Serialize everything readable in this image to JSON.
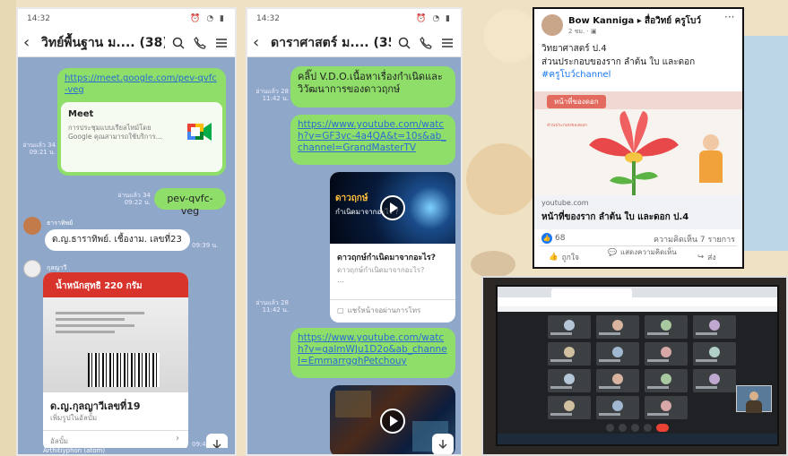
{
  "chat1": {
    "status_time": "14:32",
    "title": "วิทย์พื้นฐาน ม.... (38)",
    "link_text": "https://meet.google.com/pev-qvfc-veg",
    "meet_title": "Meet",
    "meet_desc": "การประชุมแบบเรียลไทม์โดย Google คุณสามารถใช้บริการ...",
    "read_ts1": "อ่านแล้ว 34",
    "time_ts1": "09:21 น.",
    "read_ts2": "อ่านแล้ว 34",
    "time_ts2": "09:22 น.",
    "code_msg": "pev-qvfc-veg",
    "sender1": "ธาราทิพย์",
    "msg1": "ด.ญ.ธาราทิพย์. เชื้องาม. เลขที่23",
    "msg1_time": "09:39 น.",
    "sender2": "กุลญาวี",
    "img_label": "น้ำหนักสุทธิ 220 กรัม",
    "album_title": "ด.ญ.กุลญาวีเลขที่19",
    "album_sub": "เพิ่มรูปในอัลบั้ม",
    "album_btn": "อัลบั้ม",
    "album_time": "09:41 น.",
    "bottom_sender": "Arthitiyphon (atom)"
  },
  "chat2": {
    "status_time": "14:32",
    "title": "ดาราศาสตร์ ม.... (35)",
    "read_ts1": "อ่านแล้ว 28",
    "time_ts1": "11:42 น.",
    "msg1": "คลิ๊ป V.D.O.เนื้อหาเรื่องกำเนิดและวิวัฒนาการของดาวฤกษ์",
    "link1": "https://www.youtube.com/watch?v=GF3vc-4a4QA&t=10s&ab_channel=GrandMasterTV",
    "thumb1_title": "ดาวฤกษ์",
    "thumb1_sub": "กำเนิดมาจากอะไร ?",
    "card_title": "ดาวฤกษ์กำเนิดมาจากอะไร?",
    "card_desc": "ดาวฤกษ์กำเนิดมาจากอะไร?",
    "card_more": "...",
    "share_text": "แชร์หน้าจอผ่านการโทร",
    "read_ts2": "อ่านแล้ว 28",
    "time_ts2": "11:42 น.",
    "link2": "https://www.youtube.com/watch?v=galmWJu1D2o&ab_channel=EmmarrgghPetchouy"
  },
  "fb": {
    "author": "Bow Kanniga",
    "page": "สื่อวิทย์ ครูโบว์",
    "time": "2 ชม. · ",
    "line1": "วิทยาศาสตร์ ป.4",
    "line2": "ส่วนประกอบของราก ลำต้น ใบ และดอก",
    "hashtag": "#ครูโบว์channel",
    "img_tag": "หน้าที่ของดอก",
    "img_small": "ส่วนประกอบของดอก",
    "domain": "youtube.com",
    "link_title": "หน้าที่ของราก ลำต้น ใบ และดอก ป.4",
    "reactions": "68",
    "comments": "ความคิดเห็น 7 รายการ",
    "like": "ถูกใจ",
    "comment": "แสดงความคิดเห็น",
    "share": "ส่ง",
    "more": "···"
  },
  "meet": {
    "tiles": [
      "",
      "",
      "",
      "",
      "",
      "",
      "",
      "",
      "",
      "",
      "",
      "",
      "",
      "",
      ""
    ]
  },
  "colors": {
    "line_bg": "#8fa7c9",
    "line_green": "#8ede69",
    "fb_blue": "#1877f2",
    "meet_bg": "#2b2724"
  }
}
